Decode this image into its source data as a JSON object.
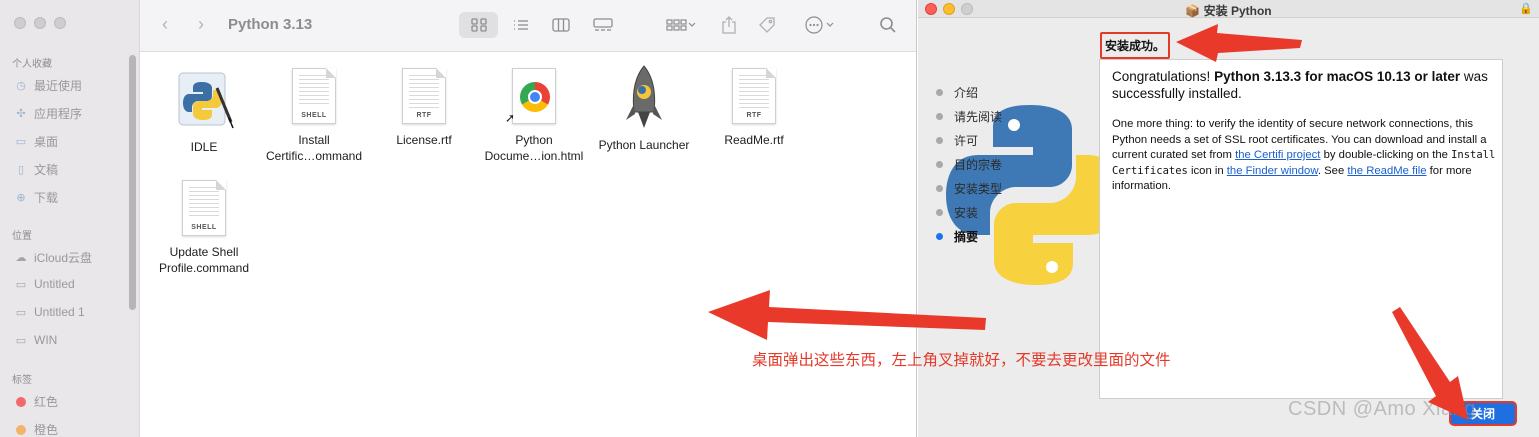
{
  "finder": {
    "title": "Python 3.13",
    "sidebar": {
      "sections": [
        {
          "title": "个人收藏",
          "items": [
            {
              "label": "最近使用",
              "icon": "clock-icon"
            },
            {
              "label": "应用程序",
              "icon": "apps-icon"
            },
            {
              "label": "桌面",
              "icon": "desktop-icon"
            },
            {
              "label": "文稿",
              "icon": "document-icon"
            },
            {
              "label": "下载",
              "icon": "download-icon"
            }
          ]
        },
        {
          "title": "位置",
          "items": [
            {
              "label": "iCloud云盘",
              "icon": "cloud-icon"
            },
            {
              "label": "Untitled",
              "icon": "disk-icon"
            },
            {
              "label": "Untitled 1",
              "icon": "disk-icon"
            },
            {
              "label": "WIN",
              "icon": "disk-icon"
            }
          ]
        },
        {
          "title": "标签",
          "items": [
            {
              "label": "红色",
              "color": "#f06a6a"
            },
            {
              "label": "橙色",
              "color": "#f2b36b"
            }
          ]
        }
      ]
    },
    "files": [
      {
        "name": "IDLE",
        "type": "app"
      },
      {
        "name1": "Install",
        "name2": "Certific…ommand",
        "tag": "SHELL"
      },
      {
        "name": "License.rtf",
        "tag": "RTF"
      },
      {
        "name1": "Python",
        "name2": "Docume…ion.html"
      },
      {
        "name": "Python Launcher",
        "type": "app"
      },
      {
        "name": "ReadMe.rtf",
        "tag": "RTF"
      },
      {
        "name1": "Update Shell",
        "name2": "Profile.command",
        "tag": "SHELL"
      }
    ]
  },
  "installer": {
    "title": "安装 Python",
    "steps": [
      "介绍",
      "请先阅读",
      "许可",
      "目的宗卷",
      "安装类型",
      "安装",
      "摘要"
    ],
    "current_step": 6,
    "success_heading": "安装成功。",
    "congrats_prefix": "Congratulations! ",
    "congrats_bold": "Python 3.13.3 for macOS 10.13 or later",
    "congrats_suffix": " was successfully installed.",
    "body_1": "One more thing: to verify the identity of secure network connections, this Python needs a set of SSL root certificates.  You can download and install a current curated set from ",
    "link_certifi": "the Certifi project",
    "body_2": " by double-clicking on the ",
    "mono_install_certs": "Install Certificates",
    "body_3": " icon in ",
    "link_finder": "the Finder window",
    "body_4": ".  See ",
    "link_readme": "the ReadMe file",
    "body_5": " for more information.",
    "close_label": "关闭"
  },
  "annotation": {
    "text": "桌面弹出这些东西，左上角叉掉就好，不要去更改里面的文件",
    "color": "#e33a2a"
  },
  "watermark": "CSDN @Amo Xiang"
}
